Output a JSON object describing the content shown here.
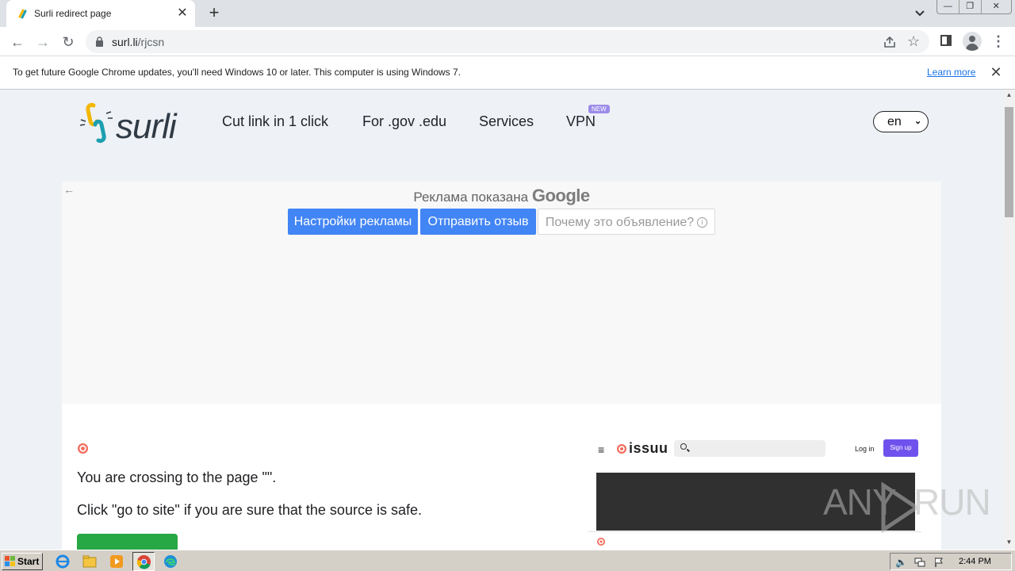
{
  "browser": {
    "tab": {
      "title": "Surli redirect page",
      "close": "✕"
    },
    "new_tab": "+",
    "window_buttons": [
      "—",
      "❐",
      "✕"
    ],
    "url": {
      "host": "surl.li",
      "path": "/rjcsn"
    },
    "infobar": {
      "text": "To get future Google Chrome updates, you'll need Windows 10 or later. This computer is using Windows 7.",
      "link": "Learn more",
      "close": "✕"
    }
  },
  "site": {
    "logo_text": "surli",
    "nav": [
      {
        "label": "Cut link in 1 click"
      },
      {
        "label": "For .gov .edu"
      },
      {
        "label": "Services"
      },
      {
        "label": "VPN",
        "badge": "NEW"
      }
    ],
    "language": "en"
  },
  "ad": {
    "title_prefix": "Реклама показана",
    "title_brand": "Google",
    "buttons": {
      "settings": "Настройки рекламы",
      "feedback": "Отправить отзыв",
      "why": "Почему это объявление?"
    },
    "info_glyph": "i"
  },
  "content": {
    "crossing": "You are crossing to the page \"\".",
    "instruction": "Click \"go to site\" if you are sure that the source is safe."
  },
  "preview": {
    "brand": "issuu",
    "login": "Log in",
    "signup": "Sign up"
  },
  "watermark": {
    "left": "ANY",
    "right": "RUN"
  },
  "taskbar": {
    "start": "Start",
    "clock": "2:44 PM"
  },
  "colors": {
    "ad_button_blue": "#4285f4",
    "go_button_green": "#28a745",
    "issuu_signup": "#6f52ed",
    "link_blue": "#1a73e8"
  }
}
